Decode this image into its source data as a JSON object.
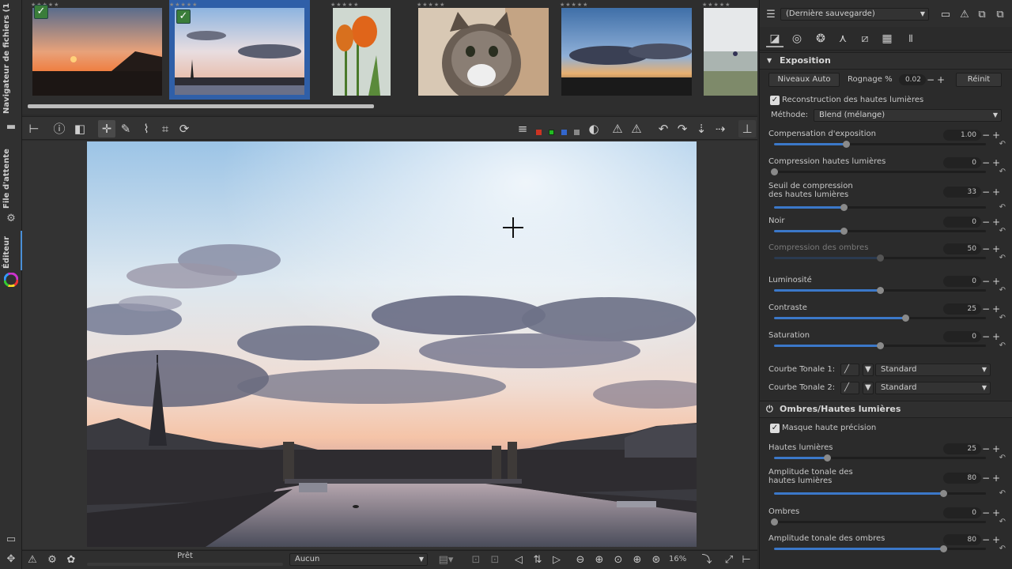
{
  "left_tabs": {
    "file_browser": "Navigateur de fichiers",
    "file_browser_count": "(1",
    "queue": "File d'attente",
    "editor": "Éditeur"
  },
  "bottom_bar": {
    "status": "Prêt",
    "preview_select": "Aucun",
    "zoom": "16%"
  },
  "right_panel": {
    "profile_combo": "(Dernière sauvegarde)",
    "exposure": {
      "title": "Exposition",
      "auto_levels": "Niveaux Auto",
      "clip_label": "Rognage %",
      "clip_value": "0.02",
      "reset": "Réinit",
      "highlight_recon": "Reconstruction des hautes lumières",
      "method_label": "Méthode:",
      "method_value": "Blend (mélange)",
      "sliders": [
        {
          "label": "Compensation d'exposition",
          "value": "1.00",
          "fill": 0.34
        },
        {
          "label": "Compression hautes lumières",
          "value": "0",
          "fill": 0.0
        },
        {
          "label": "Seuil de compression des hautes lumières",
          "label1": "Seuil de compression",
          "label2": "des hautes lumières",
          "value": "33",
          "fill": 0.33
        },
        {
          "label": "Noir",
          "value": "0",
          "fill": 0.33
        },
        {
          "label": "Compression des ombres",
          "value": "50",
          "fill": 0.5
        },
        {
          "label": "Luminosité",
          "value": "0",
          "fill": 0.5
        },
        {
          "label": "Contraste",
          "value": "25",
          "fill": 0.62
        },
        {
          "label": "Saturation",
          "value": "0",
          "fill": 0.5
        }
      ],
      "curve1_label": "Courbe Tonale 1:",
      "curve1_value": "Standard",
      "curve2_label": "Courbe Tonale 2:",
      "curve2_value": "Standard"
    },
    "shadows_highlights": {
      "title": "Ombres/Hautes lumières",
      "sharp_mask": "Masque haute précision",
      "sliders": [
        {
          "label": "Hautes lumières",
          "value": "25",
          "fill": 0.25
        },
        {
          "label": "Amplitude tonale des hautes lumières",
          "label1": "Amplitude tonale des",
          "label2": "hautes lumières",
          "value": "80",
          "fill": 0.8
        },
        {
          "label": "Ombres",
          "value": "0",
          "fill": 0.0
        },
        {
          "label": "Amplitude tonale des ombres",
          "value": "80",
          "fill": 0.8
        }
      ]
    }
  }
}
